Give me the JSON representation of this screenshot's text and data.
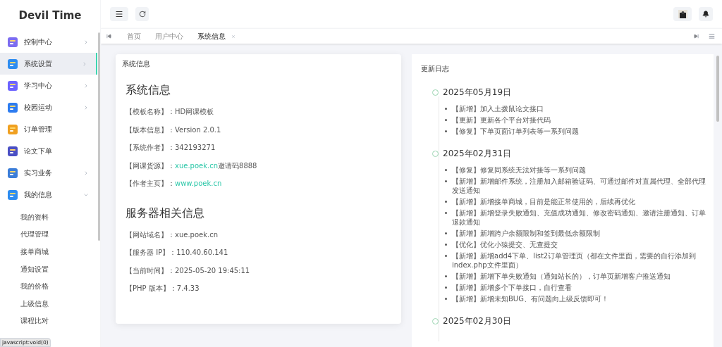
{
  "sidebar": {
    "logo": "Devil Time",
    "items": [
      {
        "label": "控制中心",
        "kind": "group",
        "selected": false,
        "expanded": false
      },
      {
        "label": "系统设置",
        "kind": "group",
        "selected": true,
        "expanded": false
      },
      {
        "label": "学习中心",
        "kind": "group",
        "selected": false,
        "expanded": false
      },
      {
        "label": "校园运动",
        "kind": "group",
        "selected": false,
        "expanded": false
      },
      {
        "label": "订单管理",
        "kind": "link",
        "selected": false
      },
      {
        "label": "论文下单",
        "kind": "link",
        "selected": false
      },
      {
        "label": "实习业务",
        "kind": "group",
        "selected": false,
        "expanded": false
      },
      {
        "label": "我的信息",
        "kind": "group",
        "selected": false,
        "expanded": true,
        "children": [
          {
            "label": "我的资料"
          },
          {
            "label": "代理管理"
          },
          {
            "label": "接单商城"
          },
          {
            "label": "通知设置"
          },
          {
            "label": "我的价格"
          },
          {
            "label": "上级信息"
          },
          {
            "label": "课程比对"
          }
        ]
      }
    ]
  },
  "tabs": [
    {
      "label": "首页",
      "selected": false,
      "closable": false
    },
    {
      "label": "用户中心",
      "selected": false,
      "closable": false
    },
    {
      "label": "系统信息",
      "selected": true,
      "closable": true
    }
  ],
  "system_card": {
    "title": "系统信息",
    "sections": [
      {
        "heading": "系统信息",
        "rows": [
          {
            "label": "【模板名称】：",
            "value": "HD网课模板"
          },
          {
            "label": "【版本信息】：",
            "value": "Version 2.0.1"
          },
          {
            "label": "【系统作者】：",
            "value": "342193271"
          },
          {
            "label": "【网课货源】：",
            "link": "xue.poek.cn",
            "value": "邀请码8888"
          },
          {
            "label": "【作者主页】：",
            "link": "www.poek.cn"
          }
        ]
      },
      {
        "heading": "服务器相关信息",
        "rows": [
          {
            "label": "【网站域名】：",
            "value": "xue.poek.cn"
          },
          {
            "label": "【服务器 IP】：",
            "value": "110.40.60.141"
          },
          {
            "label": "【当前时间】：",
            "value": "2025-05-20 19:45:11"
          },
          {
            "label": "【PHP 版本】：",
            "value": "7.4.33"
          }
        ]
      }
    ]
  },
  "changelog": {
    "title": "更新日志",
    "entries": [
      {
        "date": "2025年05月19日",
        "items": [
          "【新增】加入土拨鼠论文接口",
          "【更新】更新各个平台对接代码",
          "【修复】下单页面订单列表等一系列问题"
        ]
      },
      {
        "date": "2025年02月31日",
        "items": [
          "【修复】修复同系统无法对接等一系列问题",
          "【新增】新增邮件系统，注册加入邮箱验证码、可通过邮件对直属代理、全部代理发送通知",
          "【新增】新增接单商城，目前是能正常使用的，后续再优化",
          "【新增】新增登录失败通知、充值成功通知、修改密码通知、邀请注册通知、订单退款通知",
          "【新增】新增跨户余额限制和签到最低余额限制",
          "【优化】优化小猿提交、无查提交",
          "【新增】新增add4下单、list2订单管理页（都在文件里面，需要的自行添加到index.php文件里面）",
          "【新增】新增下单失败通知（通知站长的），订单页新增客户推送通知",
          "【新增】新增多个下单接口，自行查看",
          "【新增】新增未知BUG、有问题向上级反馈即可！"
        ]
      },
      {
        "date": "2025年02月30日"
      }
    ]
  },
  "status_text": "javascript:void(0)"
}
